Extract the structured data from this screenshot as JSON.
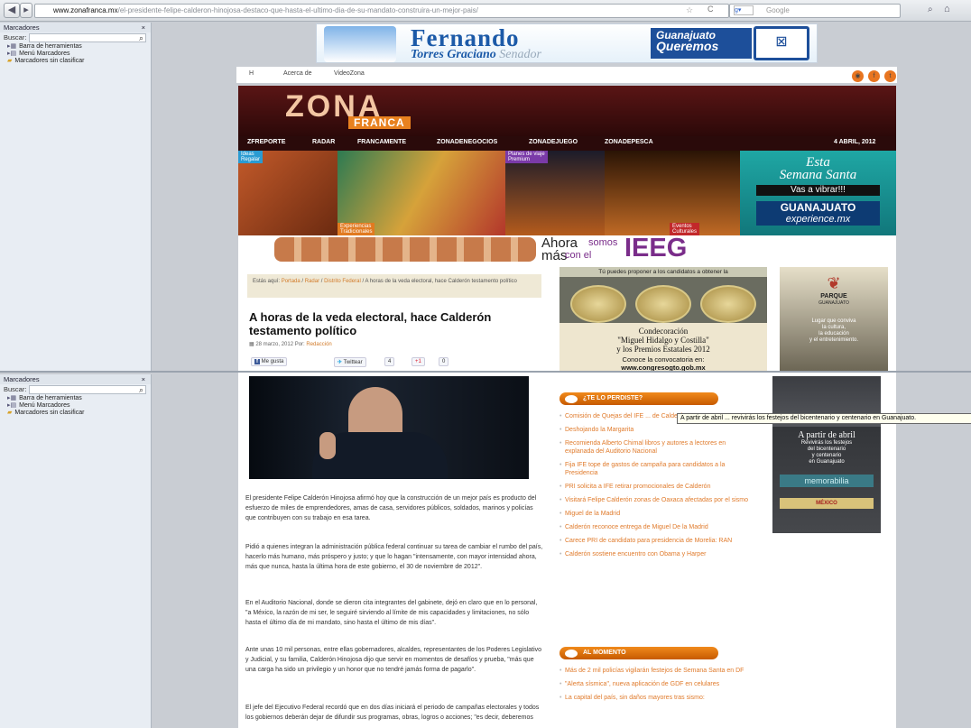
{
  "browser": {
    "url_domain": "www.zonafranca.mx",
    "url_path": "/el-presidente-felipe-calderon-hinojosa-destaco-que-hasta-el-ultimo-dia-de-su-mandato-construira-un-mejor-pais/",
    "search_placeholder": "Google"
  },
  "sidebar": {
    "title": "Marcadores",
    "close": "×",
    "search_label": "Buscar:",
    "items": [
      {
        "label": "Barra de herramientas"
      },
      {
        "label": "Menú Marcadores"
      },
      {
        "label": "Marcadores sin clasificar"
      }
    ]
  },
  "banner": {
    "name_line1": "Fernando",
    "name_line2": "Torres Graciano",
    "name_role": "Senador",
    "slogan_line1": "Guanajuato",
    "slogan_line2": "Queremos"
  },
  "topnav": {
    "home": "H",
    "about": "Acerca de",
    "video": "VideoZona"
  },
  "masthead": {
    "logo_main": "ZONA",
    "logo_sub": "FRANCA"
  },
  "nav": {
    "items": [
      "ZFREPORTE",
      "RADAR",
      "FRANCAMENTE",
      "ZONADENEGOCIOS",
      "ZONADEJUEGO",
      "ZONADEPESCA"
    ],
    "date": "4 ABRIL, 2012"
  },
  "photostrip": {
    "tag1_top": "Ideas",
    "tag1_bottom": "Regalar",
    "tag2_top": "Experiencias",
    "tag2_bottom": "Tradicionales",
    "tag3_top": "Planes de viaje",
    "tag3_bottom": "Premium",
    "tag4_top": "Eventos",
    "tag4_bottom": "Culturales",
    "semana_line1": "Esta",
    "semana_line2": "Semana Santa",
    "semana_line3": "Vas a vibrar!!!",
    "semana_line4": "GUANAJUATO",
    "semana_line5": "experience.mx"
  },
  "ieeg": {
    "ahora": "Ahora",
    "somos": "somos",
    "mas": "más",
    "con_el": "con el",
    "brand": "IEEG"
  },
  "article": {
    "breadcrumb_prefix": "Estás aquí:",
    "crumb1": "Portada",
    "crumb2": "Radar",
    "crumb3": "Distrito Federal",
    "crumb_current": "A horas de la veda electoral, hace Calderón testamento político",
    "title": "A horas de la veda electoral, hace Calderón testamento político",
    "date": "28 marzo, 2012 Por:",
    "author": "Redacción",
    "like": "Me gusta",
    "tweet": "Twittear",
    "tweet_count": "4",
    "plus": "+1",
    "plus_count": "0",
    "paragraphs": [
      "El presidente Felipe Calderón Hinojosa afirmó hoy que la construcción de un mejor país es producto del esfuerzo de miles de emprendedores, amas de casa, servidores públicos, soldados, marinos y policías que contribuyen con su trabajo en esa tarea.",
      "Pidió a quienes integran la administración pública federal continuar su tarea de cambiar el rumbo del país, hacerlo más humano, más próspero y justo; y que lo hagan \"intensamente, con mayor intensidad ahora, más que nunca, hasta la última hora de este gobierno, el 30 de noviembre de 2012\".",
      "En el Auditorio Nacional, donde se dieron cita integrantes del gabinete, dejó en claro que en lo personal, \"a México, la razón de mi ser, le seguiré sirviendo al límite de mis capacidades y limitaciones, no sólo hasta el último día de mi mandato, sino hasta el último de mis días\".",
      "Ante unas 10 mil personas, entre ellas gobernadores, alcaldes, representantes de los Poderes Legislativo y Judicial, y su familia, Calderón Hinojosa dijo que servir en momentos de desafíos y prueba, \"más que una carga ha sido un privilegio y un honor que no tendré jamás forma de pagarlo\".",
      "El jefe del Ejecutivo Federal recordó que en dos días iniciará el periodo de campañas electorales y todos los gobiernos deberán dejar de difundir sus programas, obras, logros o acciones; \"es decir, deberemos"
    ]
  },
  "condecoracion": {
    "header": "Tú puedes proponer a los candidatos a obtener la",
    "line1": "Condecoración",
    "line2": "\"Miguel Hidalgo y Costilla\"",
    "line3": "y los Premios Estatales 2012",
    "line4": "Conoce la convocatoria en:",
    "line5": "www.congresogto.gob.mx"
  },
  "parque": {
    "name": "PARQUE",
    "sub": "GUANAJUATO",
    "tagline1": "Lugar que conviva",
    "tagline2": "la cultura,",
    "tagline3": "la educación",
    "tagline4": "y el entretenimiento."
  },
  "te_lo_perdiste": {
    "heading": "¿TE LO PERDISTE?",
    "links": [
      "Comisión de Quejas del IFE ... de Calderón",
      "Deshojando la Margarita",
      "Recomienda Alberto Chimal libros y autores a lectores en explanada del Auditorio Nacional",
      "Fija IFE tope de gastos de campaña para candidatos a la Presidencia",
      "PRI solicita a IFE retirar promocionales de Calderón",
      "Visitará Felipe Calderón zonas de Oaxaca afectadas por el sismo",
      "Miguel de la Madrid",
      "Calderón reconoce entrega de Miguel De la Madrid",
      "Carece PRI de candidato para presidencia de Morelia: RAN",
      "Calderón sostiene encuentro con Obama y Harper"
    ]
  },
  "al_momento": {
    "heading": "AL MOMENTO",
    "links": [
      "Más de 2 mil policías vigilarán festejos de Semana Santa en DF",
      "\"Alerta sísmica\", nueva aplicación de GDF en celulares",
      "La capital del país, sin daños mayores tras sismo:"
    ]
  },
  "tooltip": "A partir de abril ... revivirás los festejos del bicentenario y centenario en Guanajuato.",
  "ad_abril": {
    "line1": "A partir de abril",
    "line2": "Revivirás los festejos",
    "line3": "del bicentenario",
    "line4": "y centenario",
    "line5": "en Guanajuato",
    "brand": "memorabilia",
    "footer": "MÉXICO"
  }
}
